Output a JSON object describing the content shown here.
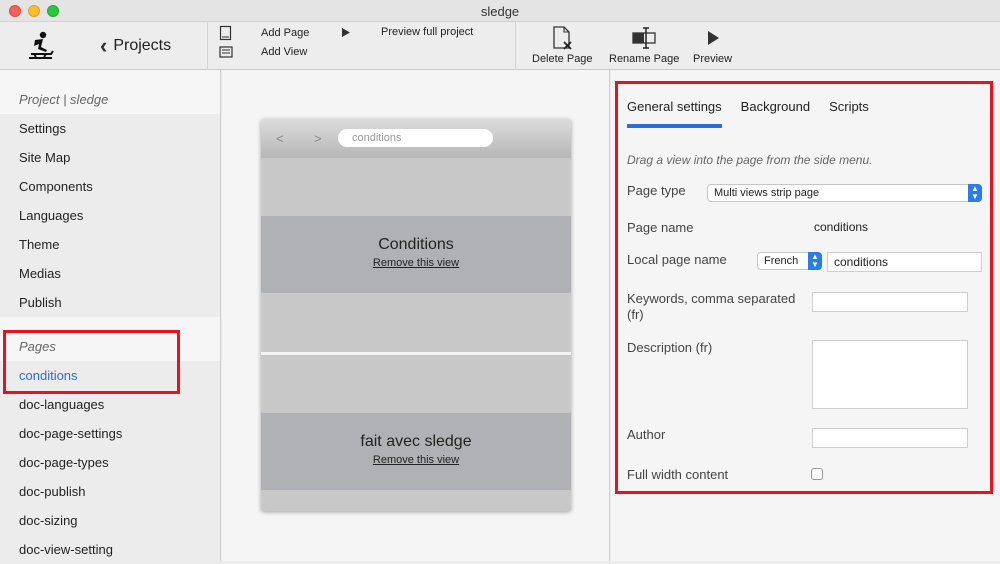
{
  "window": {
    "title": "sledge"
  },
  "toolbar": {
    "back_label": "Projects",
    "add_page": "Add Page",
    "add_view": "Add View",
    "preview_full": "Preview full project",
    "delete_page": "Delete Page",
    "rename_page": "Rename Page",
    "preview": "Preview"
  },
  "sidebar": {
    "project_section": "Project | sledge",
    "project_items": [
      "Settings",
      "Site Map",
      "Components",
      "Languages",
      "Theme",
      "Medias",
      "Publish"
    ],
    "pages_section": "Pages",
    "pages": [
      "conditions",
      "doc-languages",
      "doc-page-settings",
      "doc-page-types",
      "doc-publish",
      "doc-sizing",
      "doc-view-setting"
    ],
    "selected_page": "conditions"
  },
  "preview": {
    "back_arrow": "<",
    "forward_arrow": ">",
    "url": "conditions",
    "views": [
      {
        "title": "Conditions",
        "remove": "Remove this view"
      },
      {
        "title": "fait avec sledge",
        "remove": "Remove this view"
      }
    ]
  },
  "settings": {
    "tabs": [
      "General settings",
      "Background",
      "Scripts"
    ],
    "active_tab": "General settings",
    "hint": "Drag a view into the page from the side menu.",
    "page_type_label": "Page type",
    "page_type_value": "Multi views strip page",
    "page_name_label": "Page name",
    "page_name_value": "conditions",
    "local_page_name_label": "Local page name",
    "language_value": "French",
    "local_page_name_value": "conditions",
    "keywords_label": "Keywords, comma separated (fr)",
    "keywords_value": "",
    "description_label": "Description (fr)",
    "description_value": "",
    "author_label": "Author",
    "author_value": "",
    "full_width_label": "Full width content",
    "full_width_checked": false
  },
  "colors": {
    "accent": "#2b6fd6",
    "highlight": "#e8121d"
  }
}
